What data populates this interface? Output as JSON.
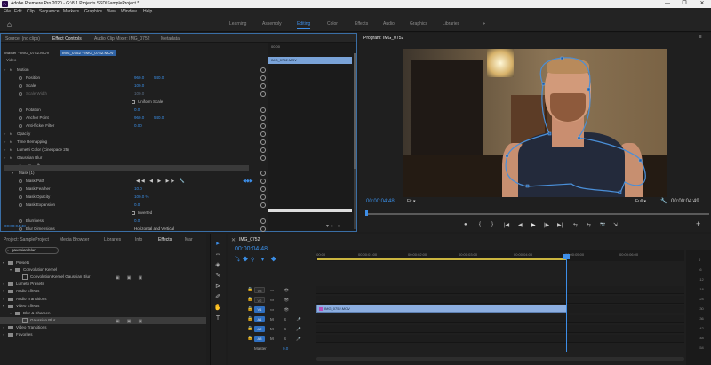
{
  "app": {
    "title": "Adobe Premiere Pro 2020 - G:\\8.1 Projects SSD\\SampleProject *",
    "window_controls": [
      "—",
      "❐",
      "✕"
    ],
    "menu": [
      "File",
      "Edit",
      "Clip",
      "Sequence",
      "Markers",
      "Graphics",
      "View",
      "Window",
      "Help"
    ]
  },
  "workspaces": {
    "items": [
      "Learning",
      "Assembly",
      "Editing",
      "Color",
      "Effects",
      "Audio",
      "Graphics",
      "Libraries"
    ],
    "active": "Editing",
    "more": "»"
  },
  "effect_controls": {
    "tabs": [
      "Source: (no clips)",
      "Effect Controls",
      "Audio Clip Mixer: IMG_0752",
      "Metadata"
    ],
    "active_tab": "Effect Controls",
    "master": "Master * IMG_0752.MOV",
    "clip": "IMG_0752 * IMG_0752.MOV",
    "ruler_time": "00:00",
    "clip_bar": "IMG_0752.MOV",
    "section_video": "Video",
    "rows": [
      {
        "type": "fx",
        "label": "Motion"
      },
      {
        "type": "prop",
        "label": "Position",
        "value": "960.0",
        "value2": "540.0"
      },
      {
        "type": "prop",
        "label": "Scale",
        "value": "100.0"
      },
      {
        "type": "prop",
        "label": "Scale Width",
        "value": "100.0",
        "dim": true
      },
      {
        "type": "check",
        "label": "Uniform Scale"
      },
      {
        "type": "prop",
        "label": "Rotation",
        "value": "0.0"
      },
      {
        "type": "prop",
        "label": "Anchor Point",
        "value": "960.0",
        "value2": "540.0"
      },
      {
        "type": "prop",
        "label": "Anti-flicker Filter",
        "value": "0.00"
      },
      {
        "type": "fx",
        "label": "Opacity"
      },
      {
        "type": "fx",
        "label": "Time Remapping"
      },
      {
        "type": "fx",
        "label": "Lumetri Color (Cinespace 25)"
      },
      {
        "type": "fx",
        "label": "Gaussian Blur"
      },
      {
        "type": "shapes",
        "label": ""
      },
      {
        "type": "mask",
        "label": "Mask (1)"
      },
      {
        "type": "prop",
        "label": "Mask Path"
      },
      {
        "type": "prop",
        "label": "Mask Feather",
        "value": "10.0"
      },
      {
        "type": "prop",
        "label": "Mask Opacity",
        "value": "100.0 %"
      },
      {
        "type": "prop",
        "label": "Mask Expansion",
        "value": "0.0"
      },
      {
        "type": "check",
        "label": "Inverted"
      },
      {
        "type": "prop",
        "label": "Blurriness",
        "value": "0.0"
      },
      {
        "type": "prop",
        "label": "Blur Dimensions",
        "value": "Horizontal and Vertical"
      }
    ],
    "timecode": "00:00:04:48"
  },
  "program": {
    "title": "Program: IMG_0752",
    "timecode_left": "00:00:04:48",
    "fit": "Fit",
    "quality": "Full",
    "timecode_right": "00:00:04:49",
    "transport": [
      "●",
      "{",
      "}",
      "|◀",
      "◀|",
      "▶",
      "|▶",
      "▶|",
      "⇆",
      "⇆",
      "📷",
      "⇲"
    ],
    "add": "+"
  },
  "project": {
    "tabs": [
      "Project: SampleProject",
      "Media Browser",
      "Libraries",
      "Info",
      "Effects",
      "Mar"
    ],
    "active_tab": "Effects",
    "search": "gaussian blur",
    "tree": [
      {
        "depth": 0,
        "kind": "folder",
        "label": "Presets",
        "open": true
      },
      {
        "depth": 1,
        "kind": "folder",
        "label": "Convolution Kernel",
        "open": true
      },
      {
        "depth": 2,
        "kind": "fx",
        "label": "Convolution Kernel Gaussian Blur"
      },
      {
        "depth": 0,
        "kind": "folder",
        "label": "Lumetri Presets"
      },
      {
        "depth": 0,
        "kind": "folder",
        "label": "Audio Effects"
      },
      {
        "depth": 0,
        "kind": "folder",
        "label": "Audio Transitions"
      },
      {
        "depth": 0,
        "kind": "folder",
        "label": "Video Effects",
        "open": true
      },
      {
        "depth": 1,
        "kind": "folder",
        "label": "Blur & Sharpen",
        "open": true
      },
      {
        "depth": 2,
        "kind": "fx",
        "label": "Gaussian Blur",
        "selected": true
      },
      {
        "depth": 0,
        "kind": "folder",
        "label": "Video Transitions"
      },
      {
        "depth": 0,
        "kind": "folder",
        "label": "Favorites"
      }
    ]
  },
  "tools": [
    "▸",
    "⇔",
    "◈",
    "✎",
    "⊳",
    "↔",
    "✐",
    "✋",
    "T"
  ],
  "timeline": {
    "tab": "IMG_0752",
    "timecode": "00:00:04:48",
    "ticks": [
      ":00:00",
      "00:00:01:00",
      "00:00:02:00",
      "00:00:03:00",
      "00:00:04:00",
      "00:00:05:00",
      "00:00:06:00"
    ],
    "video_tracks": [
      "V3",
      "V2",
      "V1"
    ],
    "audio_tracks": [
      "A1",
      "A2",
      "A3"
    ],
    "master_label": "Master",
    "master_value": "0.0",
    "clip_label": "IMG_0752.MOV",
    "meter_labels": [
      "0",
      "-6",
      "-12",
      "-18",
      "-24",
      "-30",
      "-36",
      "-42",
      "-48",
      "-54"
    ]
  },
  "colors": {
    "accent": "#3d8ee8",
    "clip": "#8caee0",
    "workarea": "#c9b43f"
  }
}
